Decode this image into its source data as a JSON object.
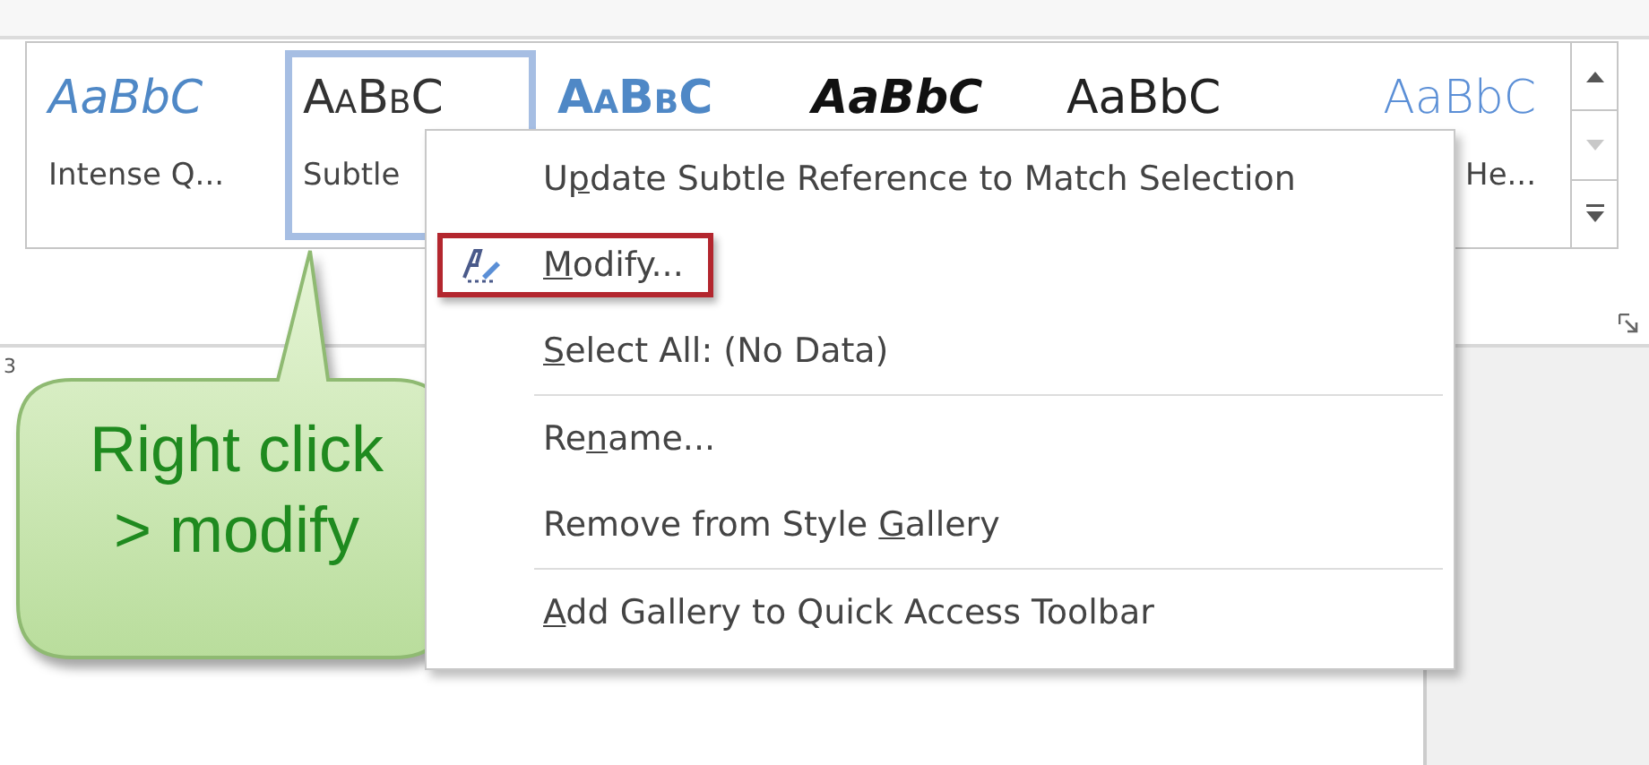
{
  "gallery": {
    "items": [
      {
        "kind": "italic-blue",
        "sample": "AaBbC",
        "label": "Intense Q...",
        "selected": false
      },
      {
        "kind": "smallcaps",
        "sample": "AaBbC",
        "label": "Subtle",
        "selected": true
      },
      {
        "kind": "smallcaps-blue",
        "sample": "AaBbC",
        "selected": false
      },
      {
        "kind": "bold-italic",
        "sample": "AaBbC",
        "selected": false
      },
      {
        "kind": "plain",
        "sample": "AaBbC",
        "selected": false
      },
      {
        "kind": "light-blue",
        "sample": "AaBbC",
        "label": "He...",
        "selected": false
      }
    ],
    "scroll_down_disabled": true
  },
  "ruler": {
    "labels": [
      "3"
    ]
  },
  "context_menu": {
    "items": [
      {
        "kind": "item",
        "before": "U",
        "key": "p",
        "after": "date Subtle Reference to Match Selection",
        "highlighted": false
      },
      {
        "kind": "icon-item",
        "key": "M",
        "after": "odify...",
        "highlighted": true
      },
      {
        "kind": "item",
        "key": "S",
        "after": "elect All: (No Data)",
        "highlighted": false
      },
      {
        "kind": "separator"
      },
      {
        "kind": "item",
        "before": "Re",
        "key": "n",
        "after": "ame...",
        "highlighted": false
      },
      {
        "kind": "item",
        "before": "Remove from Style ",
        "key": "G",
        "after": "allery",
        "highlighted": false
      },
      {
        "kind": "separator"
      },
      {
        "kind": "item",
        "key": "A",
        "after": "dd Gallery to Quick Access Toolbar",
        "highlighted": false
      }
    ]
  },
  "callout": {
    "lines": [
      "Right click",
      "> modify"
    ]
  }
}
